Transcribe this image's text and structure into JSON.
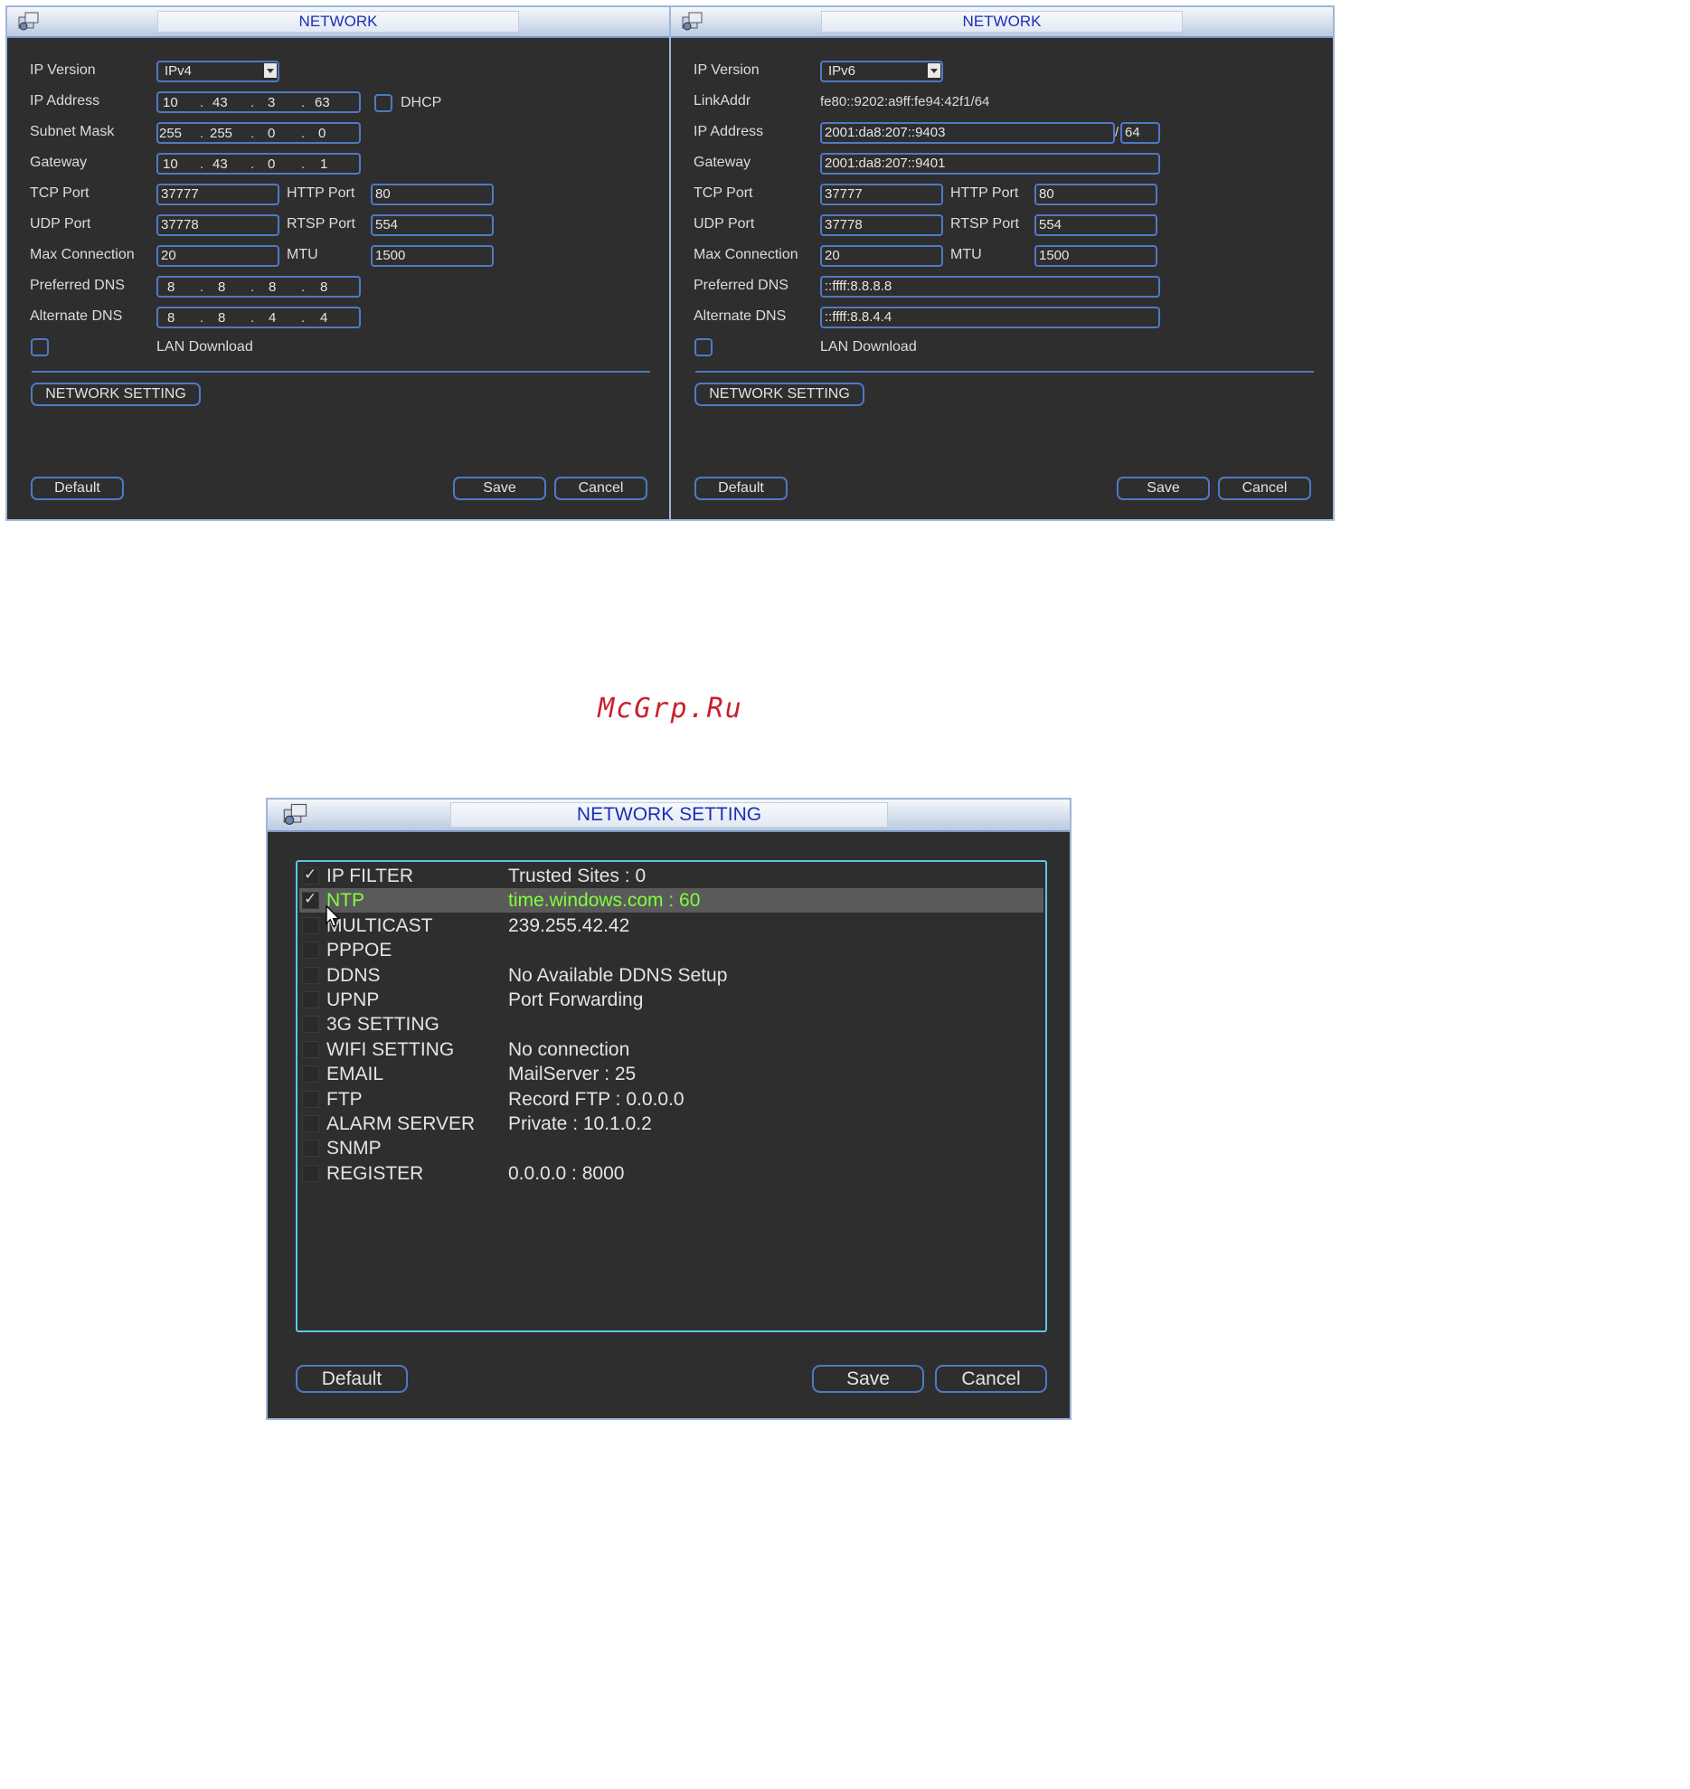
{
  "ipv4_dialog": {
    "title": "NETWORK",
    "labels": {
      "ip_version": "IP Version",
      "ip_address": "IP Address",
      "subnet_mask": "Subnet Mask",
      "gateway": "Gateway",
      "tcp_port": "TCP Port",
      "udp_port": "UDP Port",
      "max_connection": "Max Connection",
      "preferred_dns": "Preferred DNS",
      "alternate_dns": "Alternate DNS",
      "http_port": "HTTP Port",
      "rtsp_port": "RTSP Port",
      "mtu": "MTU",
      "dhcp": "DHCP",
      "lan_download": "LAN Download"
    },
    "ip_version": "IPv4",
    "ip_address": [
      "10",
      "43",
      "3",
      "63"
    ],
    "subnet_mask": [
      "255",
      "255",
      "0",
      "0"
    ],
    "gateway": [
      "10",
      "43",
      "0",
      "1"
    ],
    "preferred_dns": [
      "8",
      "8",
      "8",
      "8"
    ],
    "alternate_dns": [
      "8",
      "8",
      "4",
      "4"
    ],
    "tcp_port": "37777",
    "udp_port": "37778",
    "max_connection": "20",
    "http_port": "80",
    "rtsp_port": "554",
    "mtu": "1500",
    "network_setting_button": "NETWORK SETTING",
    "default_button": "Default",
    "save_button": "Save",
    "cancel_button": "Cancel"
  },
  "ipv6_dialog": {
    "title": "NETWORK",
    "labels": {
      "ip_version": "IP Version",
      "link_addr": "LinkAddr",
      "ip_address": "IP Address",
      "gateway": "Gateway",
      "tcp_port": "TCP Port",
      "udp_port": "UDP Port",
      "max_connection": "Max Connection",
      "preferred_dns": "Preferred DNS",
      "alternate_dns": "Alternate DNS",
      "http_port": "HTTP Port",
      "rtsp_port": "RTSP Port",
      "mtu": "MTU",
      "lan_download": "LAN Download"
    },
    "ip_version": "IPv6",
    "link_addr": "fe80::9202:a9ff:fe94:42f1/64",
    "ip_address": "2001:da8:207::9403",
    "prefix_separator": "/",
    "prefix_length": "64",
    "gateway": "2001:da8:207::9401",
    "tcp_port": "37777",
    "udp_port": "37778",
    "max_connection": "20",
    "http_port": "80",
    "rtsp_port": "554",
    "mtu": "1500",
    "preferred_dns": "::ffff:8.8.8.8",
    "alternate_dns": "::ffff:8.8.4.4",
    "network_setting_button": "NETWORK SETTING",
    "default_button": "Default",
    "save_button": "Save",
    "cancel_button": "Cancel"
  },
  "watermark": "McGrp.Ru",
  "network_setting_dialog": {
    "title": "NETWORK SETTING",
    "rows": [
      {
        "name": "IP FILTER",
        "value": "Trusted Sites : 0",
        "checked": true
      },
      {
        "name": "NTP",
        "value": "time.windows.com : 60",
        "checked": true,
        "selected": true
      },
      {
        "name": "MULTICAST",
        "value": "239.255.42.42",
        "checked": false
      },
      {
        "name": "PPPOE",
        "value": "",
        "checked": false
      },
      {
        "name": "DDNS",
        "value": "No Available DDNS Setup",
        "checked": false
      },
      {
        "name": "UPNP",
        "value": "Port Forwarding",
        "checked": false
      },
      {
        "name": "3G SETTING",
        "value": "",
        "checked": false
      },
      {
        "name": "WIFI SETTING",
        "value": "No connection",
        "checked": false
      },
      {
        "name": "EMAIL",
        "value": "MailServer : 25",
        "checked": false
      },
      {
        "name": "FTP",
        "value": "Record FTP : 0.0.0.0",
        "checked": false
      },
      {
        "name": "ALARM SERVER",
        "value": "Private : 10.1.0.2",
        "checked": false
      },
      {
        "name": "SNMP",
        "value": "",
        "checked": false
      },
      {
        "name": "REGISTER",
        "value": "0.0.0.0 : 8000",
        "checked": false
      }
    ],
    "default_button": "Default",
    "save_button": "Save",
    "cancel_button": "Cancel"
  },
  "colors": {
    "panel_bg": "#2e2e2e",
    "field_border": "#4f79c6",
    "title_text": "#1a2fb8",
    "list_border": "#5bc8e0",
    "selected_text": "#7fff3c",
    "watermark": "#c8202b"
  }
}
